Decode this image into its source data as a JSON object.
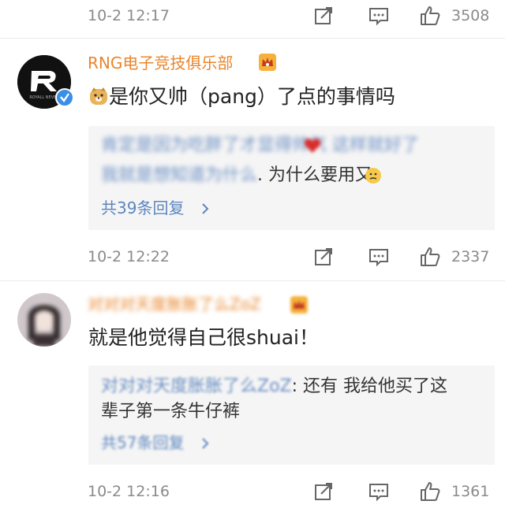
{
  "top_meta": {
    "time": "10-2 12:17",
    "likes": "3508"
  },
  "comment1": {
    "username": "RNG电子竞技俱乐部",
    "text": "是你又帅（pang）了点的事情吗",
    "reply_line1_blurred": "肯定是因为吃胖了才显得帅气 这样就好了",
    "reply_line2_blurred": "我就是想知道为什么",
    "reply_line2_text": ". 为什么要用又",
    "more_link": "共39条回复",
    "meta": {
      "time": "10-2 12:22",
      "likes": "2337"
    }
  },
  "comment2": {
    "username_blurred": "对对对天度胀胀了么ZoZ",
    "text": "就是他觉得自己很shuai！",
    "reply_name": "对对对天度胀胀了么ZoZ",
    "reply_line1_text": ": 还有 我给他买了这",
    "reply_line2_text": "辈子第一条牛仔裤",
    "more_link": "共57条回复",
    "meta": {
      "time": "10-2 12:16",
      "likes": "1361"
    }
  },
  "colors": {
    "accent_username": "#e8862c",
    "link_blue": "#5d86be",
    "meta_gray": "#8a8a8a"
  },
  "icons": [
    "share-icon",
    "comment-icon",
    "like-icon",
    "crown-badge-icon",
    "verified-icon",
    "doge-emoji-icon",
    "thinking-emoji-icon",
    "chevron-right-icon"
  ]
}
